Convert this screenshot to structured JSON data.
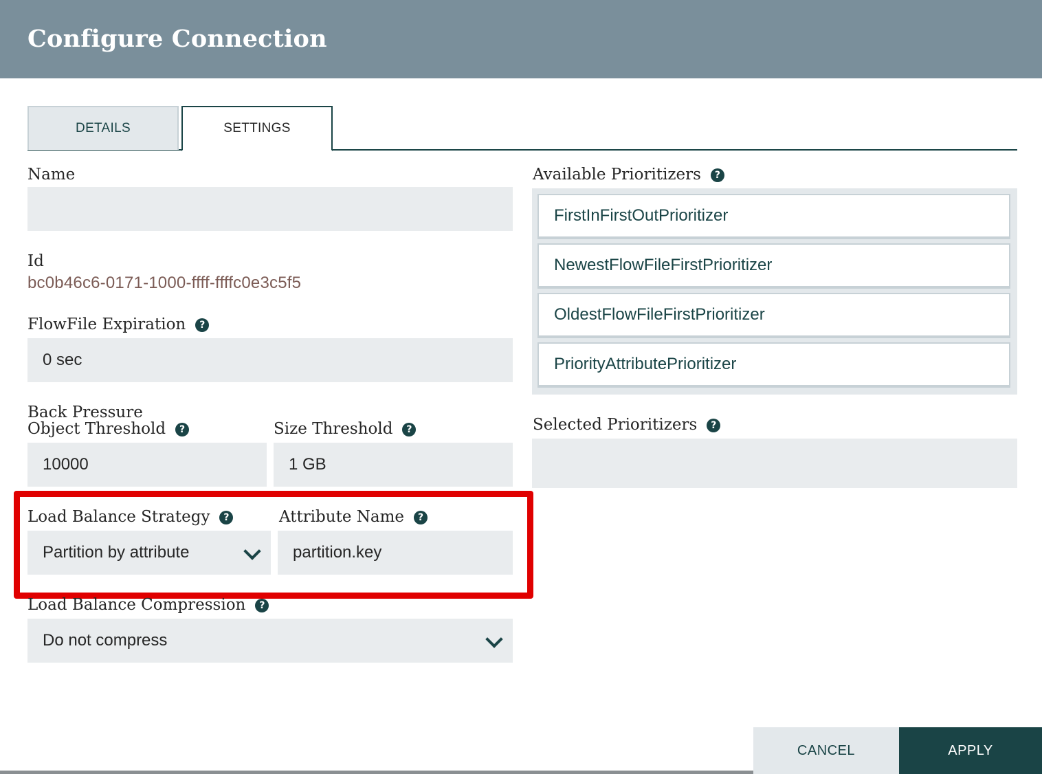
{
  "dialog": {
    "title": "Configure Connection"
  },
  "tabs": [
    {
      "label": "DETAILS",
      "active": false
    },
    {
      "label": "SETTINGS",
      "active": true
    }
  ],
  "form": {
    "name": {
      "label": "Name",
      "value": ""
    },
    "id": {
      "label": "Id",
      "value": "bc0b46c6-0171-1000-ffff-ffffc0e3c5f5"
    },
    "expiration": {
      "label": "FlowFile Expiration",
      "value": "0 sec"
    },
    "back_pressure": {
      "label_line1": "Back Pressure",
      "object_label": "Object Threshold",
      "object_value": "10000",
      "size_label": "Size Threshold",
      "size_value": "1 GB"
    },
    "lb_strategy": {
      "label": "Load Balance Strategy",
      "value": "Partition by attribute"
    },
    "attribute_name": {
      "label": "Attribute Name",
      "value": "partition.key"
    },
    "lb_compression": {
      "label": "Load Balance Compression",
      "value": "Do not compress"
    }
  },
  "prioritizers": {
    "available_label": "Available Prioritizers",
    "available": [
      "FirstInFirstOutPrioritizer",
      "NewestFlowFileFirstPrioritizer",
      "OldestFlowFileFirstPrioritizer",
      "PriorityAttributePrioritizer"
    ],
    "selected_label": "Selected Prioritizers"
  },
  "buttons": {
    "cancel": "CANCEL",
    "apply": "APPLY"
  },
  "icons": {
    "help": "question-circle-icon",
    "dropdown": "chevron-down-icon"
  },
  "colors": {
    "header": "#7a8f9b",
    "accent": "#1a4446",
    "highlight": "#e00000",
    "id_text": "#7b5b55"
  }
}
